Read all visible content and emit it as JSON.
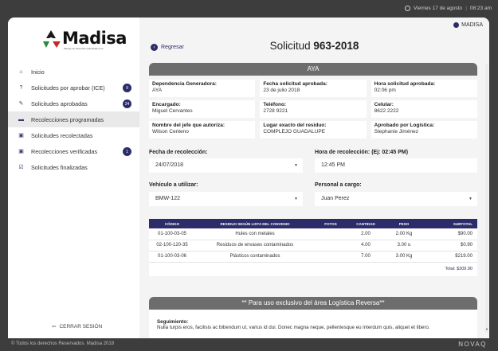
{
  "topbar": {
    "date": "Viernes 17 de agosto",
    "time": "08:23 am"
  },
  "brand": {
    "name": "Madisa",
    "subtitle": "Manejo de desechos industriales S.A."
  },
  "user": {
    "name": "MADISA"
  },
  "sidebar": {
    "items": [
      {
        "label": "Inicio",
        "icon": "home-icon",
        "glyph": "⌂",
        "badge": ""
      },
      {
        "label": "Solicitudes por aprobar (ICE)",
        "icon": "question-icon",
        "glyph": "?",
        "badge": "9"
      },
      {
        "label": "Solicitudes aprobadas",
        "icon": "edit-icon",
        "glyph": "✎",
        "badge": "24"
      },
      {
        "label": "Recolecciones programadas",
        "icon": "truck-icon",
        "glyph": "▬",
        "badge": ""
      },
      {
        "label": "Solicitudes recolectadas",
        "icon": "clipboard-icon",
        "glyph": "▣",
        "badge": ""
      },
      {
        "label": "Recolecciones verificadas",
        "icon": "clipboard-check-icon",
        "glyph": "▣",
        "badge": "1"
      },
      {
        "label": "Solicitudes finalizadas",
        "icon": "check-square-icon",
        "glyph": "☑",
        "badge": ""
      }
    ],
    "logout": "CERRAR SESIÓN"
  },
  "page": {
    "back": "Regresar",
    "title_prefix": "Solicitud",
    "title_number": "963-2018",
    "section": "AYA"
  },
  "info": {
    "dependencia_lbl": "Dependencia Generadora:",
    "dependencia_val": "AYA",
    "fecha_aprob_lbl": "Fecha solicitud aprobada:",
    "fecha_aprob_val": "23 de julio 2018",
    "hora_aprob_lbl": "Hora solicitud aprobada:",
    "hora_aprob_val": "02:06 pm",
    "encargado_lbl": "Encargado:",
    "encargado_val": "Miguel Cervantes",
    "telefono_lbl": "Teléfono:",
    "telefono_val": "2728 9221",
    "celular_lbl": "Celular:",
    "celular_val": "8622 2222",
    "jefe_lbl": "Nombre del jefe que autoriza:",
    "jefe_val": "Wilson Centeno",
    "lugar_lbl": "Lugar exacto del residuo:",
    "lugar_val": "COMPLEJO GUADALUPE",
    "logistica_lbl": "Aprobado por Logística:",
    "logistica_val": "Stephanie Jiménez"
  },
  "form": {
    "fecha_lbl": "Fecha de recolección:",
    "fecha_val": "24/07/2018",
    "hora_lbl": "Hora de recolección: (Ej: 02:45 PM)",
    "hora_val": "12:45 PM",
    "vehiculo_lbl": "Vehículo a utilizar:",
    "vehiculo_val": "BMW-122",
    "personal_lbl": "Personal a cargo:",
    "personal_val": "Juan Perez"
  },
  "table": {
    "headers": [
      "CÓDIGO",
      "RESIDUO SEGÚN LISTA DEL CONVENIO",
      "FOTOS",
      "CANTIDAD",
      "PESO",
      "SUBTOTAL"
    ],
    "rows": [
      [
        "01-100-03-05",
        "Hules con metales",
        "",
        "2.00",
        "2.00 Kg",
        "$90.00"
      ],
      [
        "02-100-120-35",
        "Residuos de envases contaminados",
        "",
        "4.00",
        "3.00 u",
        "$0.90"
      ],
      [
        "01-100-03-06",
        "Plásticos contaminados",
        "",
        "7.00",
        "3.00 Kg",
        "$219.00"
      ]
    ],
    "total": "Total: $309.90"
  },
  "reversa": {
    "header": "** Para uso exclusivo del área Logística Reversa**",
    "seguimiento_lbl": "Seguimiento:",
    "seguimiento_val": "Nulla turpis eros, facilisis ac bibendum ut, varius id dui. Donec magna neque, pellentesque eu interdum quis, aliquet et libero."
  },
  "footer": {
    "copy": "© Todos los derechos Reservados. Madisa 2018",
    "brand": "NOVAQ"
  }
}
